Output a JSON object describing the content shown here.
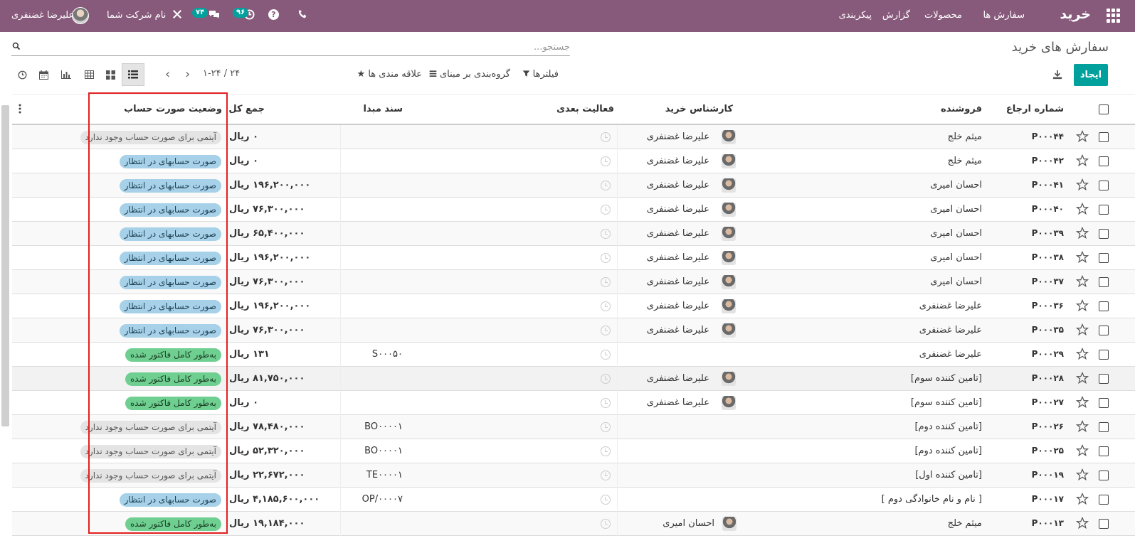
{
  "topbar": {
    "brand": "خرید",
    "menu": [
      "سفارش ها",
      "محصولات",
      "گزارش",
      "پیکربندی"
    ],
    "messages_count": "۷۴",
    "activities_count": "۹۶",
    "company": "نام شرکت شما",
    "user": "علیرضا غضنفری",
    "colors": {
      "bar": "#875a7b",
      "badge": "#00a09d"
    }
  },
  "control": {
    "breadcrumb": "سفارش های خرید",
    "search_placeholder": "جستجو...",
    "create_label": "ایجاد",
    "filters_label": "فیلترها",
    "groupby_label": "گروه‌بندی بر مبنای",
    "favorites_label": "علاقه مندی ها",
    "pager": "۱-۲۴ / ۲۴",
    "views": [
      "list",
      "kanban",
      "pivot",
      "graph",
      "calendar",
      "activity"
    ],
    "active_view": "list"
  },
  "columns": {
    "reference": "شماره ارجاع",
    "vendor": "فروشنده",
    "buyer": "کارشناس خرید",
    "next_activity": "فعالیت بعدی",
    "source": "سند مبدا",
    "total": "جمع کل",
    "invoice_status": "وضعیت صورت حساب"
  },
  "rows": [
    {
      "ref": "P۰۰۰۴۴",
      "vendor": "میثم خلج",
      "buyer": "علیرضا غضنفری",
      "source": "",
      "total": "۰ ریال",
      "status": "آیتمی برای صورت حساب وجود ندارد",
      "status_type": "none"
    },
    {
      "ref": "P۰۰۰۴۲",
      "vendor": "میثم خلج",
      "buyer": "علیرضا غضنفری",
      "source": "",
      "total": "۰ ریال",
      "status": "صورت حسابهای در انتظار",
      "status_type": "pending"
    },
    {
      "ref": "P۰۰۰۴۱",
      "vendor": "احسان امیری",
      "buyer": "علیرضا غضنفری",
      "source": "",
      "total": "۱۹۶,۲۰۰,۰۰۰ ریال",
      "status": "صورت حسابهای در انتظار",
      "status_type": "pending"
    },
    {
      "ref": "P۰۰۰۴۰",
      "vendor": "احسان امیری",
      "buyer": "علیرضا غضنفری",
      "source": "",
      "total": "۷۶,۳۰۰,۰۰۰ ریال",
      "status": "صورت حسابهای در انتظار",
      "status_type": "pending"
    },
    {
      "ref": "P۰۰۰۳۹",
      "vendor": "احسان امیری",
      "buyer": "علیرضا غضنفری",
      "source": "",
      "total": "۶۵,۴۰۰,۰۰۰ ریال",
      "status": "صورت حسابهای در انتظار",
      "status_type": "pending"
    },
    {
      "ref": "P۰۰۰۳۸",
      "vendor": "احسان امیری",
      "buyer": "علیرضا غضنفری",
      "source": "",
      "total": "۱۹۶,۲۰۰,۰۰۰ ریال",
      "status": "صورت حسابهای در انتظار",
      "status_type": "pending"
    },
    {
      "ref": "P۰۰۰۳۷",
      "vendor": "احسان امیری",
      "buyer": "علیرضا غضنفری",
      "source": "",
      "total": "۷۶,۳۰۰,۰۰۰ ریال",
      "status": "صورت حسابهای در انتظار",
      "status_type": "pending"
    },
    {
      "ref": "P۰۰۰۳۶",
      "vendor": "علیرضا غضنفری",
      "buyer": "علیرضا غضنفری",
      "source": "",
      "total": "۱۹۶,۲۰۰,۰۰۰ ریال",
      "status": "صورت حسابهای در انتظار",
      "status_type": "pending"
    },
    {
      "ref": "P۰۰۰۳۵",
      "vendor": "علیرضا غضنفری",
      "buyer": "علیرضا غضنفری",
      "source": "",
      "total": "۷۶,۳۰۰,۰۰۰ ریال",
      "status": "صورت حسابهای در انتظار",
      "status_type": "pending"
    },
    {
      "ref": "P۰۰۰۲۹",
      "vendor": "علیرضا غضنفری",
      "buyer": "",
      "source": "S۰۰۰۵۰",
      "total": "۱۳۱ ریال",
      "status": "به‌طور کامل فاکتور شده",
      "status_type": "invoiced"
    },
    {
      "ref": "P۰۰۰۲۸",
      "vendor": "[تامین کننده سوم]",
      "buyer": "علیرضا غضنفری",
      "source": "",
      "total": "۸۱,۷۵۰,۰۰۰ ریال",
      "status": "به‌طور کامل فاکتور شده",
      "status_type": "invoiced"
    },
    {
      "ref": "P۰۰۰۲۷",
      "vendor": "[تامین کننده سوم]",
      "buyer": "علیرضا غضنفری",
      "source": "",
      "total": "۰ ریال",
      "status": "به‌طور کامل فاکتور شده",
      "status_type": "invoiced"
    },
    {
      "ref": "P۰۰۰۲۶",
      "vendor": "[تامین کننده دوم]",
      "buyer": "",
      "source": "BO۰۰۰۰۱",
      "total": "۷۸,۴۸۰,۰۰۰ ریال",
      "status": "آیتمی برای صورت حساب وجود ندارد",
      "status_type": "none"
    },
    {
      "ref": "P۰۰۰۲۵",
      "vendor": "[تامین کننده دوم]",
      "buyer": "",
      "source": "BO۰۰۰۰۱",
      "total": "۵۲,۳۲۰,۰۰۰ ریال",
      "status": "آیتمی برای صورت حساب وجود ندارد",
      "status_type": "none"
    },
    {
      "ref": "P۰۰۰۱۹",
      "vendor": "[تامین کننده اول]",
      "buyer": "",
      "source": "TE۰۰۰۰۱",
      "total": "۲۲,۶۷۲,۰۰۰ ریال",
      "status": "آیتمی برای صورت حساب وجود ندارد",
      "status_type": "none"
    },
    {
      "ref": "P۰۰۰۱۷",
      "vendor": "[ نام و نام خانوادگی دوم ]",
      "buyer": "",
      "source": "OP/۰۰۰۰۷",
      "total": "۴,۱۸۵,۶۰۰,۰۰۰ ریال",
      "status": "صورت حسابهای در انتظار",
      "status_type": "pending"
    },
    {
      "ref": "P۰۰۰۱۳",
      "vendor": "میثم خلج",
      "buyer": "احسان امیری",
      "source": "",
      "total": "۱۹,۱۸۴,۰۰۰ ریال",
      "status": "به‌طور کامل فاکتور شده",
      "status_type": "invoiced"
    }
  ]
}
